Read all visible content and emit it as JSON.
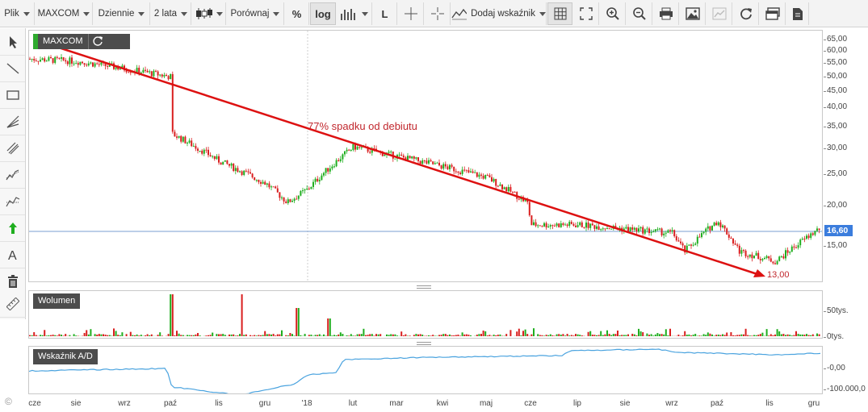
{
  "toolbar": {
    "file_menu": "Plik",
    "symbol": "MAXCOM",
    "interval": "Dziennie",
    "range": "2 lata",
    "compare": "Porównaj",
    "percent": "%",
    "log": "log",
    "linear": "L",
    "add_indicator": "Dodaj wskaźnik"
  },
  "icons": [
    "pointer-icon",
    "line-icon",
    "rectangle-icon",
    "fib-fan-icon",
    "channel-icon",
    "pitchfork-icon",
    "andrews-icon",
    "arrow-up-icon",
    "text-icon",
    "trash-icon",
    "ruler-icon"
  ],
  "price_panel": {
    "label": "MAXCOM",
    "annotation": "77% spadku od debiutu",
    "target_label": "13,00",
    "last_price": "16,60",
    "y_labels": [
      "65,00",
      "60,00",
      "55,00",
      "50,00",
      "45,00",
      "40,00",
      "35,00",
      "30,00",
      "25,00",
      "20,00",
      "15,00"
    ]
  },
  "volume_panel": {
    "label": "Wolumen",
    "y_labels": [
      "50tys.",
      "0tys."
    ]
  },
  "ad_panel": {
    "label": "Wskaźnik A/D",
    "y_labels": [
      "-0,00",
      "-100.000,0"
    ]
  },
  "x_labels": [
    "cze",
    "sie",
    "wrz",
    "paź",
    "lis",
    "gru",
    "'18",
    "lut",
    "mar",
    "kwi",
    "maj",
    "cze",
    "lip",
    "sie",
    "wrz",
    "paź",
    "lis",
    "gru"
  ],
  "copyright": "©",
  "colors": {
    "up": "#1fae1f",
    "down": "#d91f1f",
    "trend": "#dd1111",
    "ad_line": "#4aa3df",
    "last_price": "#3b7ddd"
  },
  "chart_data": [
    {
      "type": "candlestick",
      "title": "MAXCOM",
      "scale": "log",
      "ylim": [
        12,
        66
      ],
      "series": [
        {
          "name": "MAXCOM",
          "approx_close_path": [
            [
              "cze",
              57
            ],
            [
              "sie",
              56
            ],
            [
              "wrz",
              53
            ],
            [
              "paź",
              50
            ],
            [
              "paź",
              33
            ],
            [
              "lis",
              27
            ],
            [
              "gru",
              23
            ],
            [
              "gru",
              20
            ],
            [
              "'18",
              22
            ],
            [
              "lut",
              30
            ],
            [
              "mar",
              28
            ],
            [
              "kwi",
              26
            ],
            [
              "maj",
              24
            ],
            [
              "cze",
              20
            ],
            [
              "cze",
              17
            ],
            [
              "lip",
              17
            ],
            [
              "sie",
              16.5
            ],
            [
              "wrz",
              16
            ],
            [
              "paź",
              14
            ],
            [
              "paź",
              17.5
            ],
            [
              "lis",
              14
            ],
            [
              "lis",
              13
            ],
            [
              "gru",
              16.6
            ]
          ]
        }
      ],
      "annotations": [
        "77% spadku od debiutu",
        "13,00"
      ],
      "last_value": 16.6
    },
    {
      "type": "bar",
      "title": "Wolumen",
      "ylim": [
        0,
        80000
      ],
      "y_ticks": [
        "50tys.",
        "0tys."
      ]
    },
    {
      "type": "line",
      "title": "Wskaźnik A/D",
      "y_ticks": [
        "-0,00",
        "-100.000,0"
      ]
    }
  ]
}
